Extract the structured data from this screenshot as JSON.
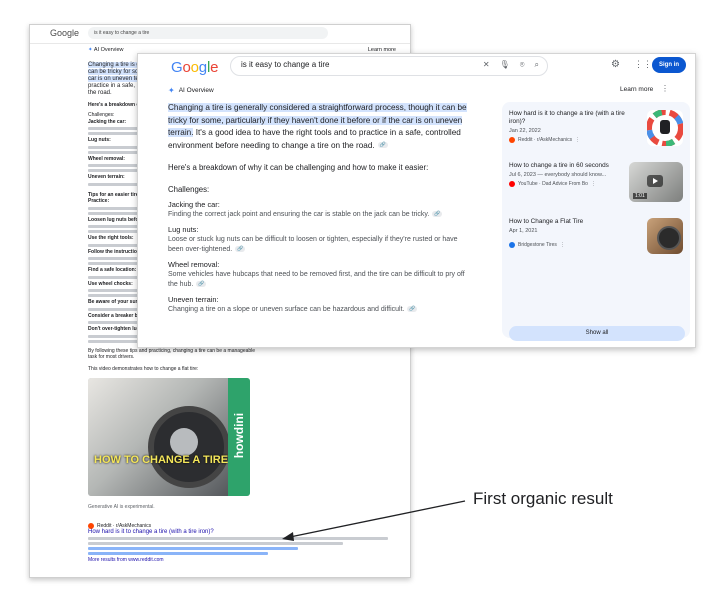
{
  "back_page": {
    "logo": "Google",
    "query": "is it easy to change a tire",
    "ai_overview_label": "AI Overview",
    "learn_more": "Learn more",
    "lead_lines": [
      "Changing a tire is generally considered a straightforward process, though it",
      "can be tricky for some, particularly if they haven't done it before or if the",
      "car is on uneven terrain. It's a good idea to have the right tools and to",
      "practice in a safe, controlled environment before needing to change a tire on",
      "the road."
    ],
    "breakdown": "Here's a breakdown of why it can be challenging and how to make it easier:",
    "challenges_label": "Challenges:",
    "tips_label": "Tips for an easier tire change:",
    "challenge_items": [
      "Jacking the car:",
      "Lug nuts:",
      "Wheel removal:",
      "Uneven terrain:"
    ],
    "tip_items": [
      "Practice:",
      "Loosen lug nuts before jacking:",
      "Use the right tools:",
      "Follow the instructions:",
      "Find a safe location:",
      "Use wheel chocks:",
      "Be aware of your surroundings:",
      "Consider a breaker bar:",
      "Don't over-tighten lug nuts:"
    ],
    "closing": "By following these tips and practicing, changing a tire can be a manageable task for most drivers.",
    "video_intro": "This video demonstrates how to change a flat tire:",
    "video_caption": "HOW TO CHANGE A TIRE",
    "video_brand": "howdini",
    "generative_note": "Generative AI is experimental.",
    "result_source": "Reddit · r/AskMechanics",
    "result_title": "How hard is it to change a tire (with a tire iron)?",
    "more_results": "More results from www.reddit.com"
  },
  "header": {
    "logo": "Google",
    "query": "is it easy to change a tire",
    "signin": "Sign in"
  },
  "ai_overview": {
    "label": "AI Overview",
    "learn_more": "Learn more",
    "lead_highlight": "Changing a tire is generally considered a straightforward process, though it can be tricky for some, particularly if they haven't done it before or if the car is on uneven terrain.",
    "lead_rest": " It's a good idea to have the right tools and to practice in a safe, controlled environment before needing to change a tire on the road.",
    "breakdown": "Here's a breakdown of why it can be challenging and how to make it easier:",
    "challenges_label": "Challenges:",
    "items": [
      {
        "title": "Jacking the car:",
        "desc": "Finding the correct jack point and ensuring the car is stable on the jack can be tricky."
      },
      {
        "title": "Lug nuts:",
        "desc": "Loose or stuck lug nuts can be difficult to loosen or tighten, especially if they're rusted or have been over-tightened."
      },
      {
        "title": "Wheel removal:",
        "desc": "Some vehicles have hubcaps that need to be removed first, and the tire can be difficult to pry off the hub."
      },
      {
        "title": "Uneven terrain:",
        "desc": "Changing a tire on a slope or uneven surface can be hazardous and difficult."
      }
    ]
  },
  "sources": {
    "cards": [
      {
        "title": "How hard is it to change a tire (with a tire iron)?",
        "date": "Jan 22, 2022",
        "source": "Reddit · r/AskMechanics",
        "thumb_color": "#e0e0e0"
      },
      {
        "title": "How to change a tire in 60 seconds",
        "date": "Jul 6, 2023 — everybody should know...",
        "source": "YouTube · Dad Advice From Bo",
        "duration": "1:01",
        "thumb_color": "#b1b2b0"
      },
      {
        "title": "How to Change a Flat Tire",
        "date": "Apr 1, 2021",
        "source": "Bridgestone Tires",
        "thumb_color": "#8a6a4a"
      }
    ],
    "show_all": "Show all"
  },
  "annotation": {
    "label": "First organic result"
  },
  "colors": {
    "accent": "#0b57d0",
    "highlight": "#d3e3fd",
    "panel": "#f3f6fc",
    "link": "#1a0dab"
  }
}
